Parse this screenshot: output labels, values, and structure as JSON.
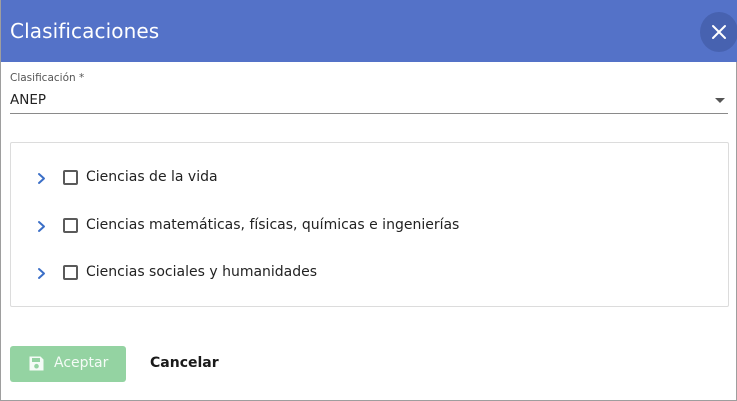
{
  "dialog": {
    "title": "Clasificaciones",
    "close_icon": "close-icon"
  },
  "classification": {
    "label": "Clasificación *",
    "value": "ANEP",
    "arrow_icon": "dropdown-arrow-icon"
  },
  "tree": {
    "items": [
      {
        "label": "Ciencias de la vida",
        "checked": false,
        "expanded": false
      },
      {
        "label": "Ciencias matemáticas, físicas, químicas e ingenierías",
        "checked": false,
        "expanded": false
      },
      {
        "label": "Ciencias sociales y humanidades",
        "checked": false,
        "expanded": false
      }
    ]
  },
  "actions": {
    "accept_label": "Aceptar",
    "accept_icon": "save-icon",
    "cancel_label": "Cancelar"
  },
  "colors": {
    "header": "#5472c8",
    "accept_button": "#94d3a2",
    "chevron": "#3b6fc7"
  }
}
